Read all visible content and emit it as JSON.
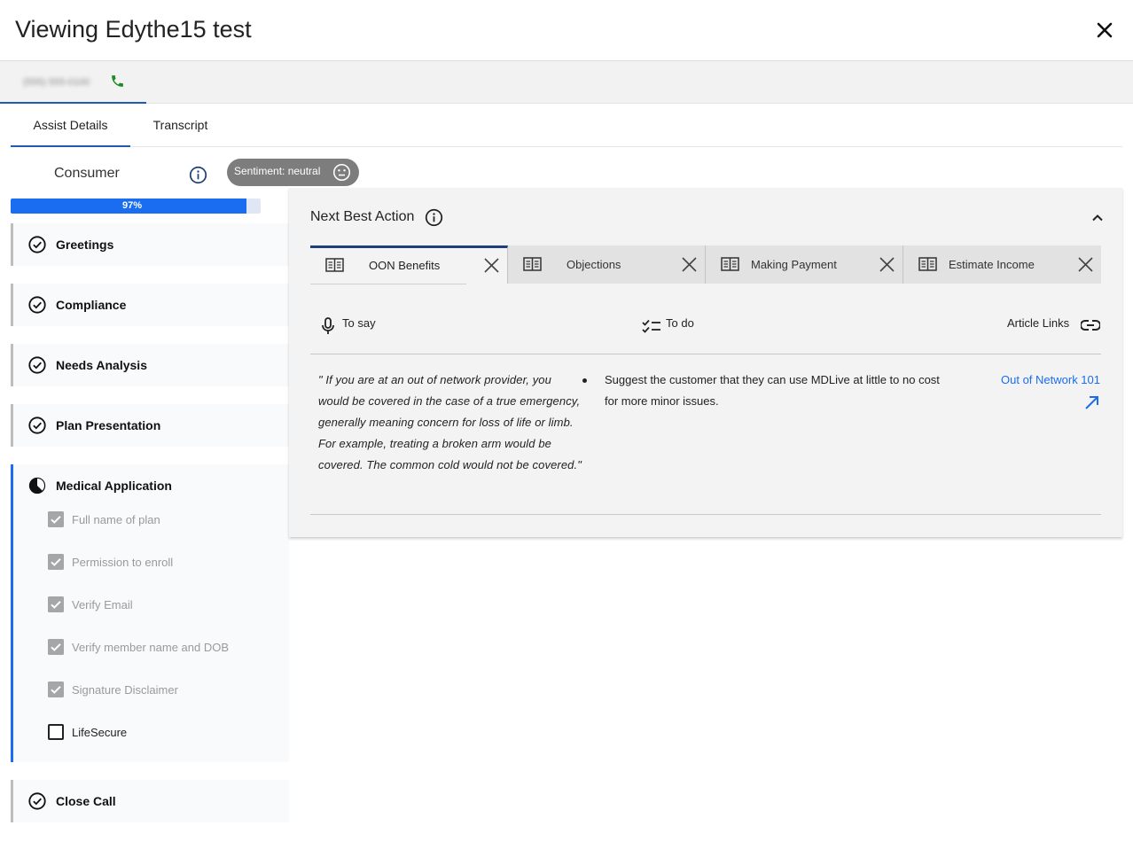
{
  "window": {
    "title": "Viewing Edythe15 test",
    "close_icon": "close-icon"
  },
  "call": {
    "number": "(555) 555-0100",
    "phone_icon": "phone-icon",
    "phone_color": "#1f8b24"
  },
  "tabs": [
    {
      "label": "Assist Details",
      "active": true
    },
    {
      "label": "Transcript",
      "active": false
    }
  ],
  "consumer": {
    "label": "Consumer",
    "sentiment_label": "Sentiment: neutral",
    "progress_percent": 97,
    "progress_text": "97%"
  },
  "checklist": [
    {
      "title": "Greetings",
      "status": "complete"
    },
    {
      "title": "Compliance",
      "status": "complete"
    },
    {
      "title": "Needs Analysis",
      "status": "complete"
    },
    {
      "title": "Plan Presentation",
      "status": "complete"
    },
    {
      "title": "Medical Application",
      "status": "in-progress",
      "items": [
        {
          "label": "Full name of plan",
          "checked": true
        },
        {
          "label": "Permission to enroll",
          "checked": true
        },
        {
          "label": "Verify Email",
          "checked": true
        },
        {
          "label": "Verify member name and DOB",
          "checked": true
        },
        {
          "label": "Signature Disclaimer",
          "checked": true
        },
        {
          "label": "LifeSecure",
          "checked": false
        }
      ]
    },
    {
      "title": "Close Call",
      "status": "complete"
    }
  ],
  "nba": {
    "title": "Next Best Action",
    "categories": [
      {
        "label": "OON Benefits",
        "active": true
      },
      {
        "label": "Objections",
        "active": false
      },
      {
        "label": "Making Payment",
        "active": false
      },
      {
        "label": "Estimate Income",
        "active": false
      }
    ],
    "columns": {
      "to_say": "To say",
      "to_do": "To do",
      "article_links": "Article Links"
    },
    "to_say_text": "\" If you are at an out of network provider, you would be covered in the case of a true emergency, generally meaning concern for loss of life or limb. For example, treating a broken arm would be covered. The common cold would not be covered.\"",
    "to_do_items": [
      "Suggest the customer that they can use MDLive at little to no cost for more minor issues."
    ],
    "article_link_label": "Out of Network 101"
  },
  "colors": {
    "accent": "#1a6cf0",
    "tab_underline": "#1e5bb5",
    "sentiment_bg": "#7d7d7d"
  }
}
